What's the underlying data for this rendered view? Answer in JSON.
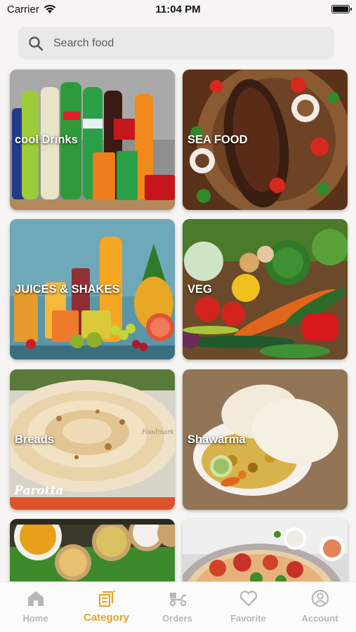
{
  "status_bar": {
    "carrier": "Carrier",
    "time": "11:04 PM"
  },
  "search": {
    "placeholder": "Search food",
    "value": ""
  },
  "categories": [
    {
      "label": "cool Drinks"
    },
    {
      "label": "SEA FOOD"
    },
    {
      "label": "JUICES & SHAKES"
    },
    {
      "label": "VEG"
    },
    {
      "label": "Breads"
    },
    {
      "label": "Shawarma"
    },
    {
      "label": ""
    },
    {
      "label": ""
    }
  ],
  "image_text": {
    "parotta_logo": "Parotta",
    "watermark": "Foodmark"
  },
  "tabbar": {
    "active": "Category",
    "active_color": "#e6a32b",
    "inactive_color": "#b7b7b7",
    "tabs": [
      {
        "label": "Home",
        "icon": "home-icon"
      },
      {
        "label": "Category",
        "icon": "category-icon"
      },
      {
        "label": "Orders",
        "icon": "delivery-scooter-icon"
      },
      {
        "label": "Favorite",
        "icon": "heart-icon"
      },
      {
        "label": "Account",
        "icon": "account-icon"
      }
    ]
  }
}
